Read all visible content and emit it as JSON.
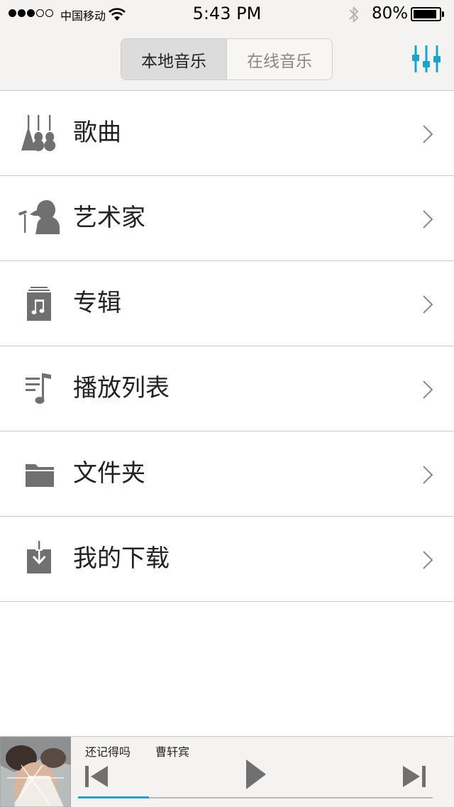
{
  "status_bar": {
    "carrier": "中国移动",
    "time": "5:43 PM",
    "battery_percent": "80%",
    "signal_bars_filled": 3,
    "signal_bars_total": 5,
    "battery_level": 0.8
  },
  "nav": {
    "segments": [
      {
        "label": "本地音乐",
        "active": true
      },
      {
        "label": "在线音乐",
        "active": false
      }
    ],
    "equalizer_icon": "equalizer-icon",
    "accent_color": "#1ca3cc"
  },
  "menu": {
    "items": [
      {
        "label": "歌曲",
        "icon": "guitars-icon"
      },
      {
        "label": "艺术家",
        "icon": "singer-icon"
      },
      {
        "label": "专辑",
        "icon": "album-icon"
      },
      {
        "label": "播放列表",
        "icon": "playlist-icon"
      },
      {
        "label": "文件夹",
        "icon": "folder-icon"
      },
      {
        "label": "我的下载",
        "icon": "download-icon"
      }
    ]
  },
  "player": {
    "title": "还记得吗",
    "artist": "曹轩宾",
    "progress": 0.2,
    "progress_color": "#2a9fd0"
  }
}
